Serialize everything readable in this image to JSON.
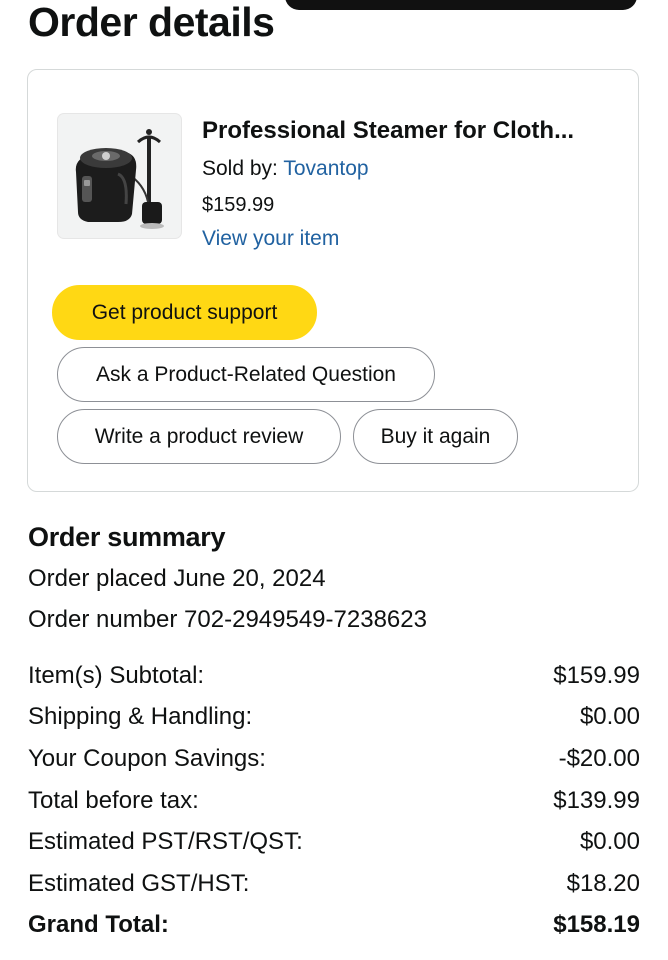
{
  "page": {
    "title": "Order details"
  },
  "product": {
    "name": "Professional Steamer for Cloth...",
    "sold_by_label": "Sold by:",
    "seller": "Tovantop",
    "price": "$159.99",
    "view_link": "View your item",
    "image_icon": "garment-steamer-icon"
  },
  "actions": {
    "support": "Get product support",
    "question": "Ask a Product-Related Question",
    "review": "Write a product review",
    "buy_again": "Buy it again"
  },
  "summary": {
    "title": "Order summary",
    "placed": "Order placed June 20, 2024",
    "number": "Order number 702-2949549-7238623",
    "rows": [
      {
        "label": "Item(s) Subtotal:",
        "value": "$159.99"
      },
      {
        "label": "Shipping & Handling:",
        "value": "$0.00"
      },
      {
        "label": "Your Coupon Savings:",
        "value": "-$20.00"
      },
      {
        "label": "Total before tax:",
        "value": "$139.99"
      },
      {
        "label": "Estimated PST/RST/QST:",
        "value": "$0.00"
      },
      {
        "label": "Estimated GST/HST:",
        "value": "$18.20"
      },
      {
        "label": "Grand Total:",
        "value": "$158.19"
      }
    ]
  },
  "colors": {
    "link": "#2162a1",
    "primary_button": "#ffd814",
    "border": "#d5d9d9"
  }
}
